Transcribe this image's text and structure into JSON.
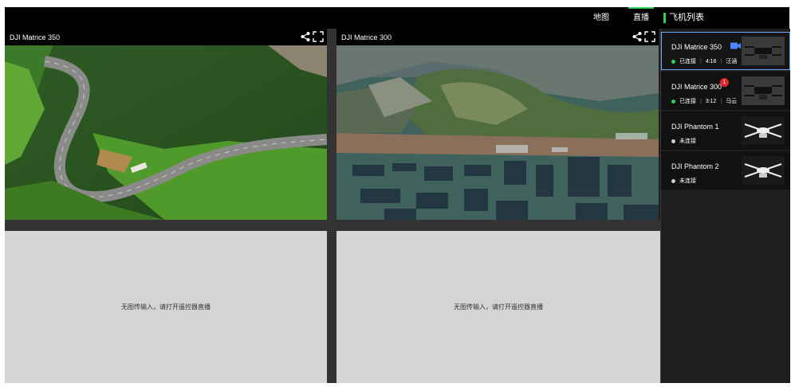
{
  "topbar": {
    "nav_map": "地图",
    "nav_live": "直播",
    "list_title": "飞机列表"
  },
  "panels": [
    {
      "title": "DJI Matrice 350",
      "no_signal_text": "无图传输入，请打开遥控器直播"
    },
    {
      "title": "DJI Matrice 300",
      "no_signal_text": "无图传输入，请打开遥控器直播"
    }
  ],
  "devices": [
    {
      "name": "DJI Matrice 350",
      "status": "已连接",
      "time": "4:16",
      "pilot": "汪涵",
      "live_icon": "video-camera-icon",
      "selected": true
    },
    {
      "name": "DJI Matrice 300",
      "status": "已连接",
      "time": "3:12",
      "pilot": "马云",
      "badge": "1",
      "selected": false
    },
    {
      "name": "DJI Phantom 1",
      "status": "未连接",
      "selected": false
    },
    {
      "name": "DJI Phantom 2",
      "status": "未连接",
      "selected": false
    }
  ],
  "colors": {
    "accent_green": "#2fd15c",
    "selected_border": "#6ea8ff",
    "connected_dot": "#2fd15c",
    "disconnected_dot": "#cfcfcf",
    "camera_icon": "#4a86ff",
    "badge": "#e0282e"
  }
}
